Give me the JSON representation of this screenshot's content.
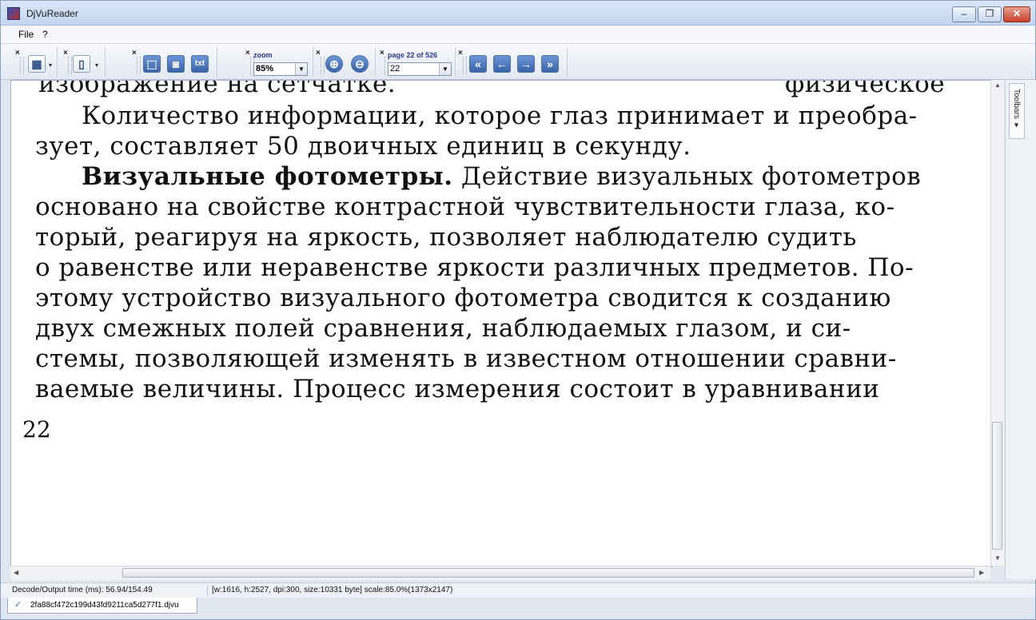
{
  "window": {
    "title": "DjVuReader"
  },
  "menu": {
    "file": "File",
    "help": "?"
  },
  "toolbar": {
    "close_mark": "×",
    "zoom_label": "zoom",
    "zoom_value": "85%",
    "page_label": "page 22 of 526",
    "page_value": "22",
    "txt_label": "txt"
  },
  "document": {
    "lines": [
      "изображение на сетчатке.",
      "Количество информации, которое глаз принимает и преобра-",
      "зует, составляет 50 двоичных единиц в секунду.",
      "Действие визуальных фотометров",
      "основано на свойстве контрастной чувствительности глаза, ко-",
      "торый, реагируя на яркость, позволяет наблюдателю судить",
      "о равенстве или неравенстве яркости различных предметов. По-",
      "этому устройство визуального фотометра сводится к созданию",
      "двух смежных полей сравнения, наблюдаемых глазом, и си-",
      "стемы, позволяющей изменять в известном отношении сравни-",
      "ваемые величины. Процесс измерения состоит в уравнивании"
    ],
    "bold_heading": "Визуальные фотометры.",
    "top_right_fragment": "физическое",
    "page_number": "22"
  },
  "sidepanel": {
    "toolbars_label": "Toolbars ▾"
  },
  "status": {
    "decode_time": "Decode/Output time (ms): 56.94/154.49",
    "page_info": "[w:1616, h:2527, dpi:300, size:10331 byte] scale:85.0%(1373x2147)"
  },
  "tabs": [
    {
      "label": "2fa88cf472c199d43fd9211ca5d277f1.djvu"
    }
  ]
}
